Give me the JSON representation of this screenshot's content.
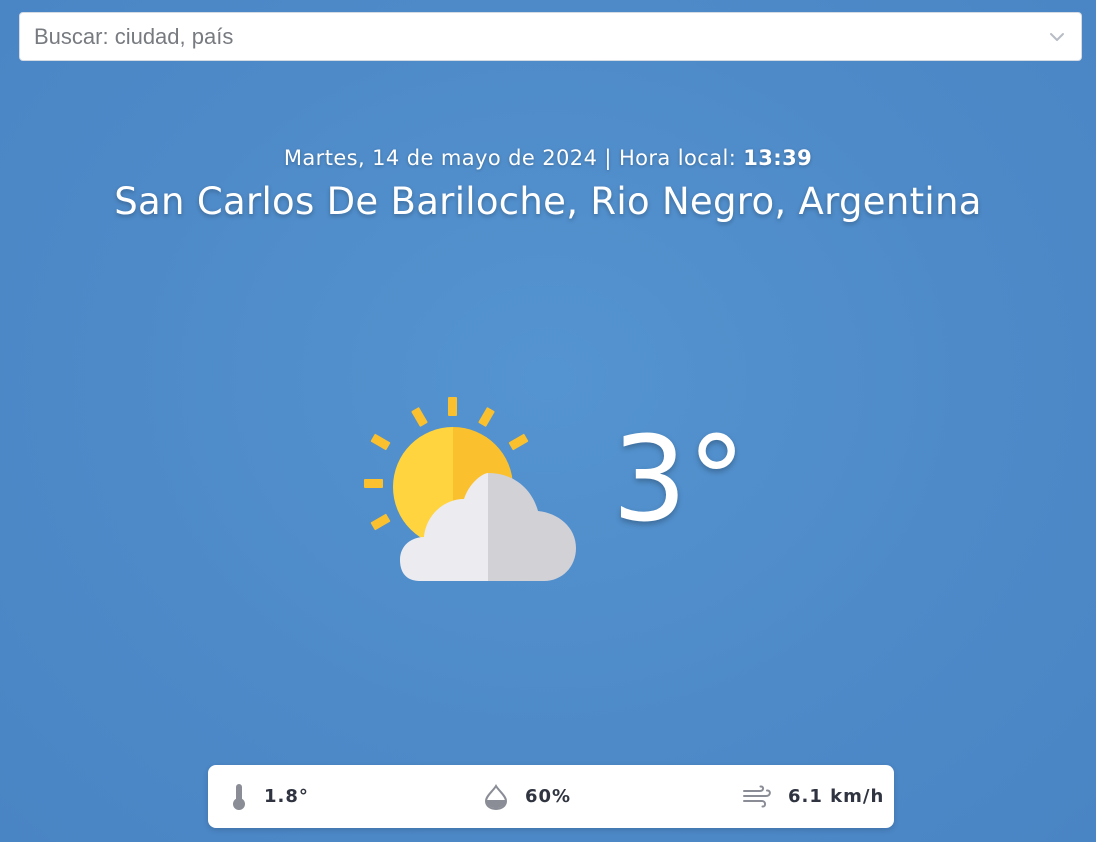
{
  "search": {
    "placeholder": "Buscar: ciudad, país"
  },
  "header": {
    "date_text": "Martes, 14 de mayo de 2024 | Hora local: ",
    "local_time": "13:39",
    "location": "San Carlos De Bariloche, Rio Negro, Argentina"
  },
  "current": {
    "temperature": "3°",
    "condition_icon": "partly-cloudy-icon"
  },
  "stats": {
    "temperature": {
      "icon": "thermometer-icon",
      "value": "1.8°"
    },
    "humidity": {
      "icon": "humidity-drop-icon",
      "value": "60%"
    },
    "wind": {
      "icon": "wind-icon",
      "value": "6.1 km/h"
    }
  },
  "colors": {
    "background": "#4e8ac8",
    "sun_light": "#ffd43f",
    "sun_dark": "#fbc02d",
    "cloud_light": "#ececf0",
    "cloud_dark": "#d2d1d6",
    "stat_icon": "#8a8d96"
  }
}
